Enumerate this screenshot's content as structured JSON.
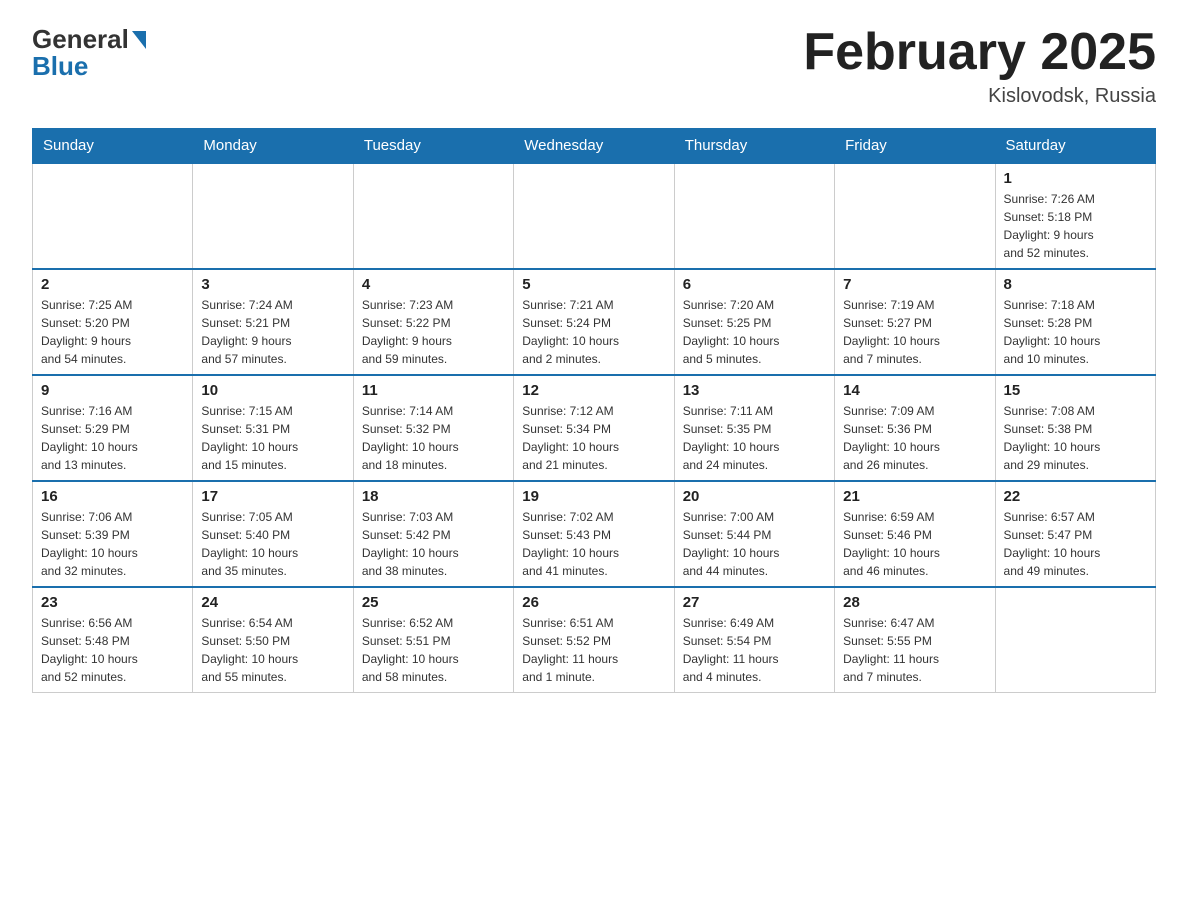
{
  "header": {
    "logo_general": "General",
    "logo_blue": "Blue",
    "month_title": "February 2025",
    "location": "Kislovodsk, Russia"
  },
  "weekdays": [
    "Sunday",
    "Monday",
    "Tuesday",
    "Wednesday",
    "Thursday",
    "Friday",
    "Saturday"
  ],
  "weeks": [
    [
      {
        "day": "",
        "info": ""
      },
      {
        "day": "",
        "info": ""
      },
      {
        "day": "",
        "info": ""
      },
      {
        "day": "",
        "info": ""
      },
      {
        "day": "",
        "info": ""
      },
      {
        "day": "",
        "info": ""
      },
      {
        "day": "1",
        "info": "Sunrise: 7:26 AM\nSunset: 5:18 PM\nDaylight: 9 hours\nand 52 minutes."
      }
    ],
    [
      {
        "day": "2",
        "info": "Sunrise: 7:25 AM\nSunset: 5:20 PM\nDaylight: 9 hours\nand 54 minutes."
      },
      {
        "day": "3",
        "info": "Sunrise: 7:24 AM\nSunset: 5:21 PM\nDaylight: 9 hours\nand 57 minutes."
      },
      {
        "day": "4",
        "info": "Sunrise: 7:23 AM\nSunset: 5:22 PM\nDaylight: 9 hours\nand 59 minutes."
      },
      {
        "day": "5",
        "info": "Sunrise: 7:21 AM\nSunset: 5:24 PM\nDaylight: 10 hours\nand 2 minutes."
      },
      {
        "day": "6",
        "info": "Sunrise: 7:20 AM\nSunset: 5:25 PM\nDaylight: 10 hours\nand 5 minutes."
      },
      {
        "day": "7",
        "info": "Sunrise: 7:19 AM\nSunset: 5:27 PM\nDaylight: 10 hours\nand 7 minutes."
      },
      {
        "day": "8",
        "info": "Sunrise: 7:18 AM\nSunset: 5:28 PM\nDaylight: 10 hours\nand 10 minutes."
      }
    ],
    [
      {
        "day": "9",
        "info": "Sunrise: 7:16 AM\nSunset: 5:29 PM\nDaylight: 10 hours\nand 13 minutes."
      },
      {
        "day": "10",
        "info": "Sunrise: 7:15 AM\nSunset: 5:31 PM\nDaylight: 10 hours\nand 15 minutes."
      },
      {
        "day": "11",
        "info": "Sunrise: 7:14 AM\nSunset: 5:32 PM\nDaylight: 10 hours\nand 18 minutes."
      },
      {
        "day": "12",
        "info": "Sunrise: 7:12 AM\nSunset: 5:34 PM\nDaylight: 10 hours\nand 21 minutes."
      },
      {
        "day": "13",
        "info": "Sunrise: 7:11 AM\nSunset: 5:35 PM\nDaylight: 10 hours\nand 24 minutes."
      },
      {
        "day": "14",
        "info": "Sunrise: 7:09 AM\nSunset: 5:36 PM\nDaylight: 10 hours\nand 26 minutes."
      },
      {
        "day": "15",
        "info": "Sunrise: 7:08 AM\nSunset: 5:38 PM\nDaylight: 10 hours\nand 29 minutes."
      }
    ],
    [
      {
        "day": "16",
        "info": "Sunrise: 7:06 AM\nSunset: 5:39 PM\nDaylight: 10 hours\nand 32 minutes."
      },
      {
        "day": "17",
        "info": "Sunrise: 7:05 AM\nSunset: 5:40 PM\nDaylight: 10 hours\nand 35 minutes."
      },
      {
        "day": "18",
        "info": "Sunrise: 7:03 AM\nSunset: 5:42 PM\nDaylight: 10 hours\nand 38 minutes."
      },
      {
        "day": "19",
        "info": "Sunrise: 7:02 AM\nSunset: 5:43 PM\nDaylight: 10 hours\nand 41 minutes."
      },
      {
        "day": "20",
        "info": "Sunrise: 7:00 AM\nSunset: 5:44 PM\nDaylight: 10 hours\nand 44 minutes."
      },
      {
        "day": "21",
        "info": "Sunrise: 6:59 AM\nSunset: 5:46 PM\nDaylight: 10 hours\nand 46 minutes."
      },
      {
        "day": "22",
        "info": "Sunrise: 6:57 AM\nSunset: 5:47 PM\nDaylight: 10 hours\nand 49 minutes."
      }
    ],
    [
      {
        "day": "23",
        "info": "Sunrise: 6:56 AM\nSunset: 5:48 PM\nDaylight: 10 hours\nand 52 minutes."
      },
      {
        "day": "24",
        "info": "Sunrise: 6:54 AM\nSunset: 5:50 PM\nDaylight: 10 hours\nand 55 minutes."
      },
      {
        "day": "25",
        "info": "Sunrise: 6:52 AM\nSunset: 5:51 PM\nDaylight: 10 hours\nand 58 minutes."
      },
      {
        "day": "26",
        "info": "Sunrise: 6:51 AM\nSunset: 5:52 PM\nDaylight: 11 hours\nand 1 minute."
      },
      {
        "day": "27",
        "info": "Sunrise: 6:49 AM\nSunset: 5:54 PM\nDaylight: 11 hours\nand 4 minutes."
      },
      {
        "day": "28",
        "info": "Sunrise: 6:47 AM\nSunset: 5:55 PM\nDaylight: 11 hours\nand 7 minutes."
      },
      {
        "day": "",
        "info": ""
      }
    ]
  ]
}
